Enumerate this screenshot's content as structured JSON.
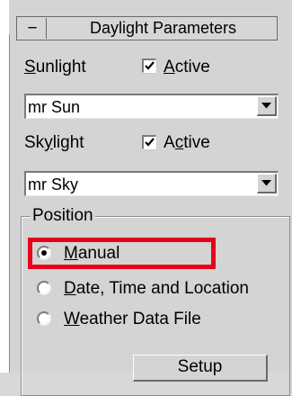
{
  "rollout": {
    "collapse_symbol": "−",
    "title": "Daylight Parameters"
  },
  "sunlight": {
    "label": "Sunlight",
    "active_label": "Active",
    "active_checked": true,
    "dropdown_value": "mr Sun"
  },
  "skylight": {
    "label": "Skylight",
    "active_label": "Active",
    "active_checked": true,
    "dropdown_value": "mr Sky"
  },
  "position": {
    "group_title": "Position",
    "options": [
      {
        "label": "Manual",
        "selected": true
      },
      {
        "label": "Date, Time and Location",
        "selected": false
      },
      {
        "label": "Weather Data File",
        "selected": false
      }
    ],
    "setup_label": "Setup"
  },
  "highlight_color": "#e8001a"
}
